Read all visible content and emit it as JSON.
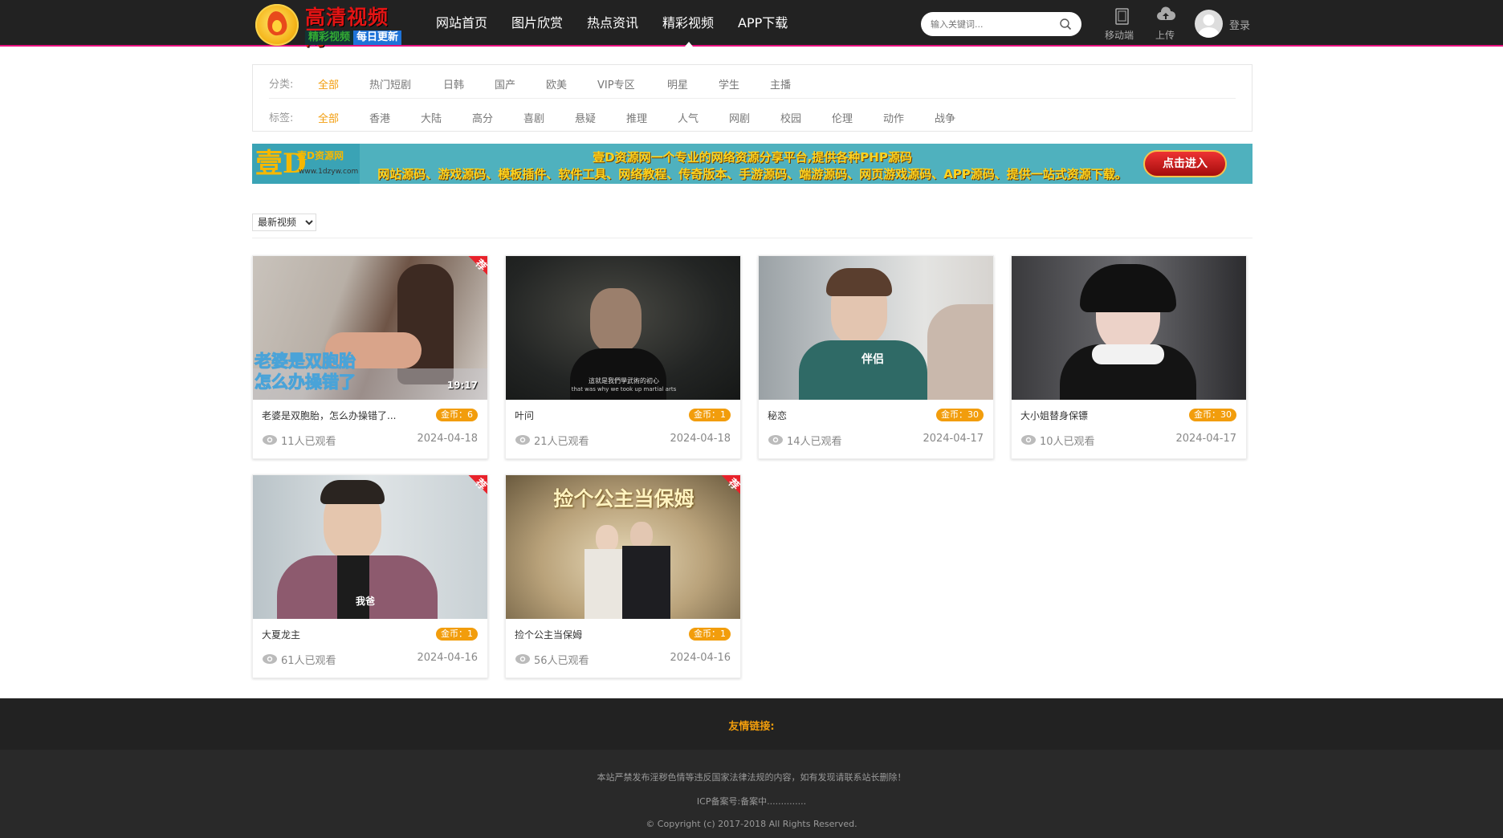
{
  "header": {
    "logo": {
      "title": "高清视频网",
      "tag1": "精彩视频",
      "tag2": "每日更新"
    },
    "nav": [
      {
        "label": "网站首页"
      },
      {
        "label": "图片欣赏"
      },
      {
        "label": "热点资讯"
      },
      {
        "label": "精彩视频"
      },
      {
        "label": "APP下载"
      }
    ],
    "active_nav": "精彩视频",
    "search": {
      "placeholder": "输入关键词..."
    },
    "mobile_label": "移动端",
    "upload_label": "上传",
    "login_label": "登录"
  },
  "filter": {
    "category_label": "分类:",
    "categories": [
      "全部",
      "热门短剧",
      "日韩",
      "国产",
      "欧美",
      "VIP专区",
      "明星",
      "学生",
      "主播"
    ],
    "tag_label": "标签:",
    "tags": [
      "全部",
      "香港",
      "大陆",
      "高分",
      "喜剧",
      "悬疑",
      "推理",
      "人气",
      "网剧",
      "校园",
      "伦理",
      "动作",
      "战争"
    ],
    "active_category": "全部",
    "active_tag": "全部"
  },
  "banner": {
    "logo_char": "壹D",
    "logo_text": "壹D资源网",
    "logo_url": "www.1dzyw.com",
    "line1": "壹D资源网一个专业的网络资源分享平台,提供各种PHP源码",
    "line2": "网站源码、游戏源码、模板插件、软件工具、网络教程、传奇版本、手游源码、端游源码、网页游戏源码、APP源码、提供一站式资源下载。",
    "button": "点击进入"
  },
  "sort": {
    "selected": "最新视频"
  },
  "rec_badge": "荐",
  "videos": [
    {
      "title": "老婆是双胞胎，怎么办操错了...",
      "coin": "金币：6",
      "views": "11人已观看",
      "date": "2024-04-18",
      "rec": true,
      "overlay": "老婆是双胞胎\n怎么办操错了",
      "duration": "19:17"
    },
    {
      "title": "叶问",
      "coin": "金币：1",
      "views": "21人已观看",
      "date": "2024-04-18",
      "rec": false,
      "subtitle": "這就是我們學武術的初心",
      "subtitle_en": "that was why we took up martial arts"
    },
    {
      "title": "秘恋",
      "coin": "金币：30",
      "views": "14人已观看",
      "date": "2024-04-17",
      "rec": false,
      "overlay": "伴侣"
    },
    {
      "title": "大小姐替身保镖",
      "coin": "金币：30",
      "views": "10人已观看",
      "date": "2024-04-17",
      "rec": false
    },
    {
      "title": "大夏龙主",
      "coin": "金币：1",
      "views": "61人已观看",
      "date": "2024-04-16",
      "rec": true,
      "overlay": "我爸"
    },
    {
      "title": "捡个公主当保姆",
      "coin": "金币：1",
      "views": "56人已观看",
      "date": "2024-04-16",
      "rec": true,
      "overlay": "捡个公主当保姆"
    }
  ],
  "footer": {
    "links_label": "友情链接:",
    "notice": "本站严禁发布淫秽色情等违反国家法律法规的内容，如有发现请联系站长删除！",
    "icp": "ICP备案号:备案中..............",
    "copyright": "© Copyright (c) 2017-2018 All Rights Reserved."
  }
}
